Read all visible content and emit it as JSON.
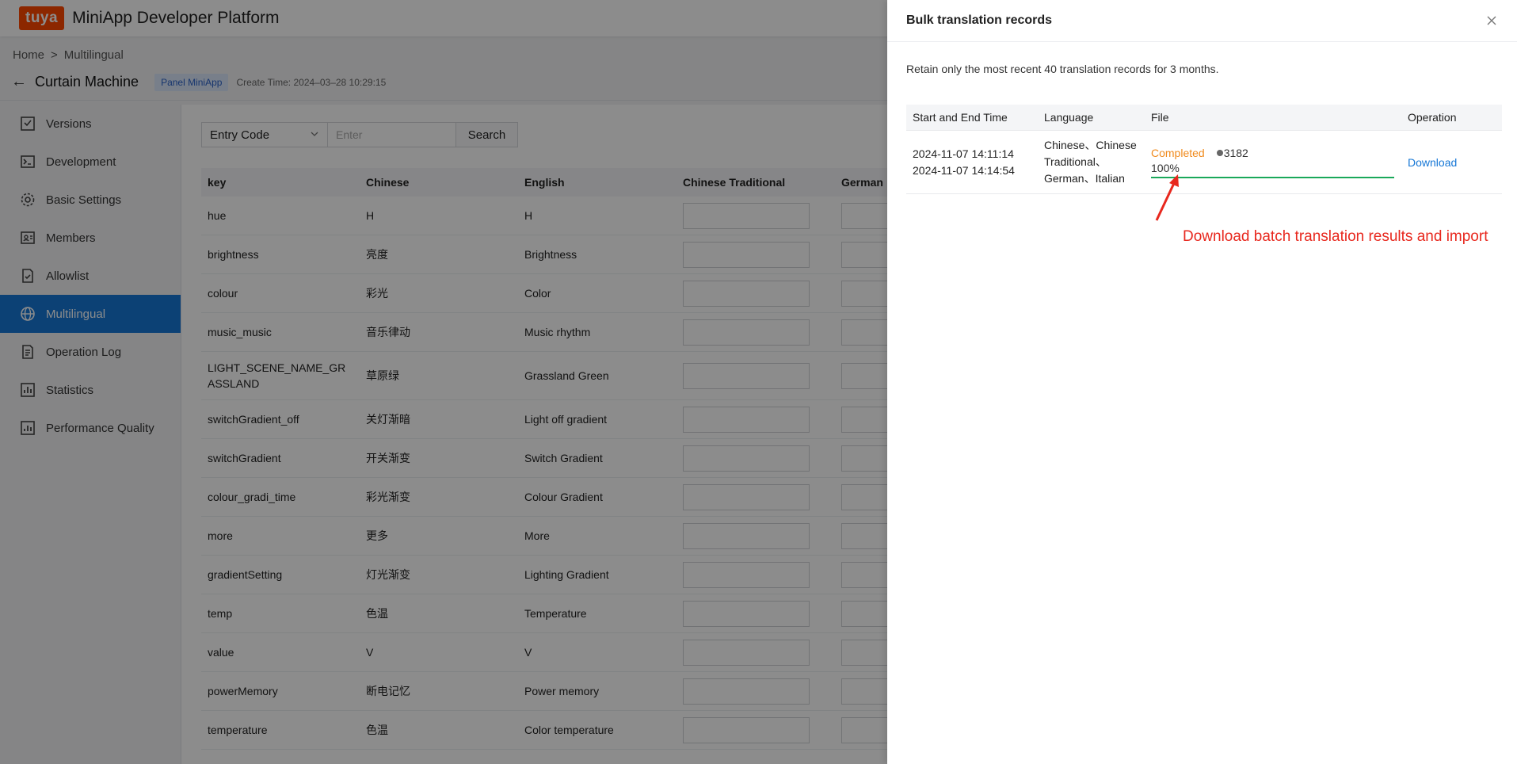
{
  "header": {
    "logo": "tuya",
    "platform_title": "MiniApp Developer Platform"
  },
  "breadcrumb": {
    "home": "Home",
    "sep": ">",
    "current": "Multilingual"
  },
  "app_info": {
    "name": "Curtain Machine",
    "tag": "Panel MiniApp",
    "create_time": "Create Time: 2024–03–28 10:29:15"
  },
  "sidebar": {
    "items": [
      {
        "label": "Versions",
        "icon": "versions-icon"
      },
      {
        "label": "Development",
        "icon": "terminal-icon"
      },
      {
        "label": "Basic Settings",
        "icon": "gear-icon"
      },
      {
        "label": "Members",
        "icon": "members-icon"
      },
      {
        "label": "Allowlist",
        "icon": "allowlist-icon"
      },
      {
        "label": "Multilingual",
        "icon": "globe-icon"
      },
      {
        "label": "Operation Log",
        "icon": "log-icon"
      },
      {
        "label": "Statistics",
        "icon": "statistics-icon"
      },
      {
        "label": "Performance Quality",
        "icon": "performance-icon"
      }
    ],
    "active": "Multilingual"
  },
  "search": {
    "filter_value": "Entry Code",
    "placeholder": "Enter",
    "button": "Search"
  },
  "table": {
    "columns": [
      "key",
      "Chinese",
      "English",
      "Chinese Traditional",
      "German"
    ],
    "rows": [
      {
        "key": "hue",
        "zh": "H",
        "en": "H"
      },
      {
        "key": "brightness",
        "zh": "亮度",
        "en": "Brightness"
      },
      {
        "key": "colour",
        "zh": "彩光",
        "en": "Color"
      },
      {
        "key": "music_music",
        "zh": "音乐律动",
        "en": "Music rhythm"
      },
      {
        "key": "LIGHT_SCENE_NAME_GRASSLAND",
        "zh": "草原绿",
        "en": "Grassland Green"
      },
      {
        "key": "switchGradient_off",
        "zh": "关灯渐暗",
        "en": "Light off gradient"
      },
      {
        "key": "switchGradient",
        "zh": "开关渐变",
        "en": "Switch Gradient"
      },
      {
        "key": "colour_gradi_time",
        "zh": "彩光渐变",
        "en": "Colour Gradient"
      },
      {
        "key": "more",
        "zh": "更多",
        "en": "More"
      },
      {
        "key": "gradientSetting",
        "zh": "灯光渐变",
        "en": "Lighting Gradient"
      },
      {
        "key": "temp",
        "zh": "色温",
        "en": "Temperature"
      },
      {
        "key": "value",
        "zh": "V",
        "en": "V"
      },
      {
        "key": "powerMemory",
        "zh": "断电记忆",
        "en": "Power memory"
      },
      {
        "key": "temperature",
        "zh": "色温",
        "en": "Color temperature"
      }
    ]
  },
  "drawer": {
    "title": "Bulk translation records",
    "note": "Retain only the most recent 40 translation records for 3 months.",
    "columns": [
      "Start and End Time",
      "Language",
      "File",
      "Operation"
    ],
    "record": {
      "start": "2024-11-07 14:11:14",
      "end": "2024-11-07 14:14:54",
      "lang_line1": "Chinese、Chinese",
      "lang_line2": "Traditional、",
      "lang_line3": "German、Italian",
      "status": "Completed",
      "count": "3182",
      "percent": "100%",
      "progress": 1.0,
      "operation": "Download"
    },
    "annotation": "Download batch translation results and import"
  },
  "colors": {
    "accent": "#1677d6",
    "status_completed": "#f08a1c",
    "progress": "#1aa85a",
    "annotation": "#e8281e",
    "logo": "#ff4800"
  }
}
